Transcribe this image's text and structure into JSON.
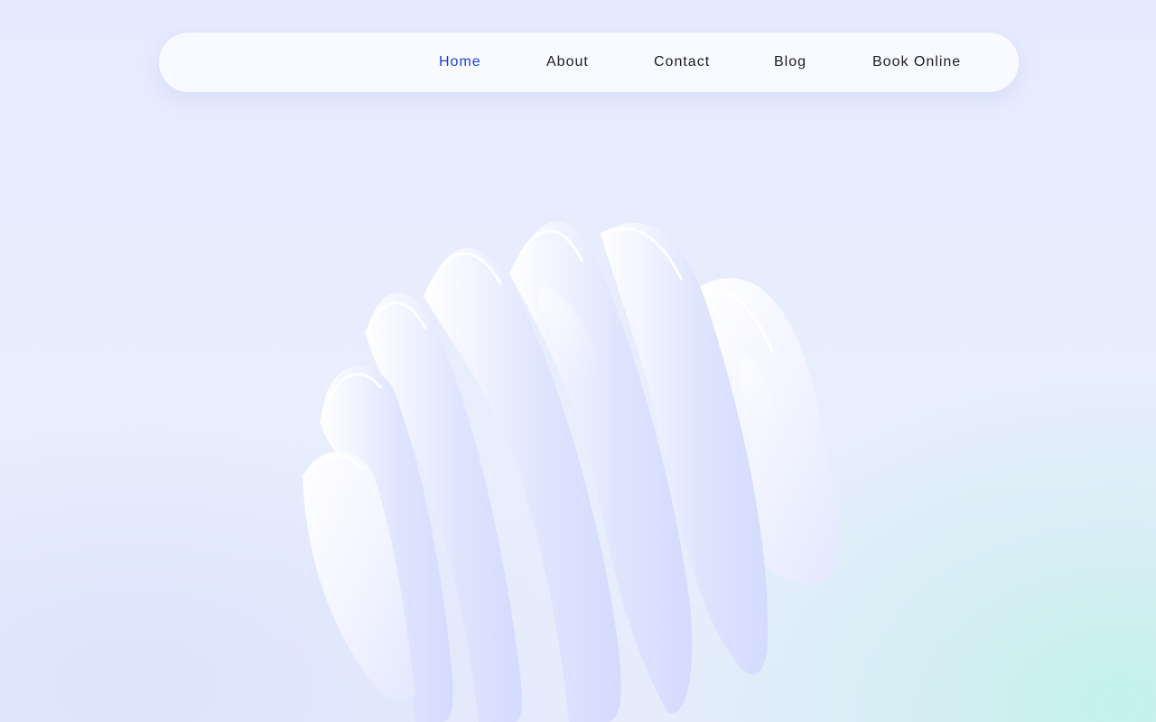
{
  "nav": {
    "items": [
      {
        "label": "Home",
        "active": true
      },
      {
        "label": "About",
        "active": false
      },
      {
        "label": "Contact",
        "active": false
      },
      {
        "label": "Blog",
        "active": false
      },
      {
        "label": "Book Online",
        "active": false
      }
    ]
  },
  "colors": {
    "accent": "#1b3fd6",
    "nav_text": "#1c1c22",
    "background": "#e8edfd",
    "corner_tint": "#c2f2ec"
  },
  "hero": {
    "art": "abstract-3d-ribbon-sculpture"
  }
}
